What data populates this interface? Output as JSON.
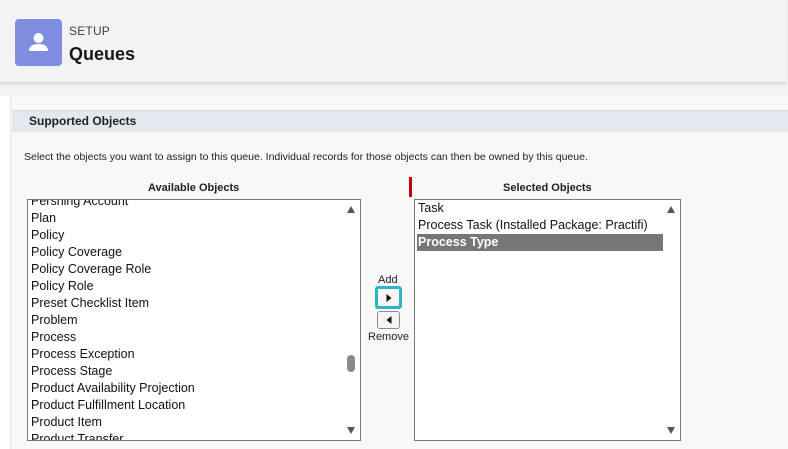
{
  "header": {
    "setup_label": "SETUP",
    "title": "Queues",
    "icon": "user-icon",
    "icon_bg": "#7f8de1"
  },
  "section": {
    "title": "Supported Objects",
    "instructions": "Select the objects you want to assign to this queue. Individual records for those objects can then be owned by this queue."
  },
  "available": {
    "label": "Available Objects",
    "items": [
      "Pershing Account",
      "Plan",
      "Policy",
      "Policy Coverage",
      "Policy Coverage Role",
      "Policy Role",
      "Preset Checklist Item",
      "Problem",
      "Process",
      "Process Exception",
      "Process Stage",
      "Product Availability Projection",
      "Product Fulfillment Location",
      "Product Item",
      "Product Transfer"
    ]
  },
  "selected": {
    "label": "Selected Objects",
    "items": [
      "Task",
      "Process Task (Installed Package: Practifi)",
      "Process Type"
    ],
    "selected_item": "Process Type"
  },
  "buttons": {
    "add_label": "Add",
    "remove_label": "Remove"
  },
  "colors": {
    "focus_ring": "#2bb5c8",
    "selection_bg": "#767676",
    "required_marker": "#c00000"
  }
}
